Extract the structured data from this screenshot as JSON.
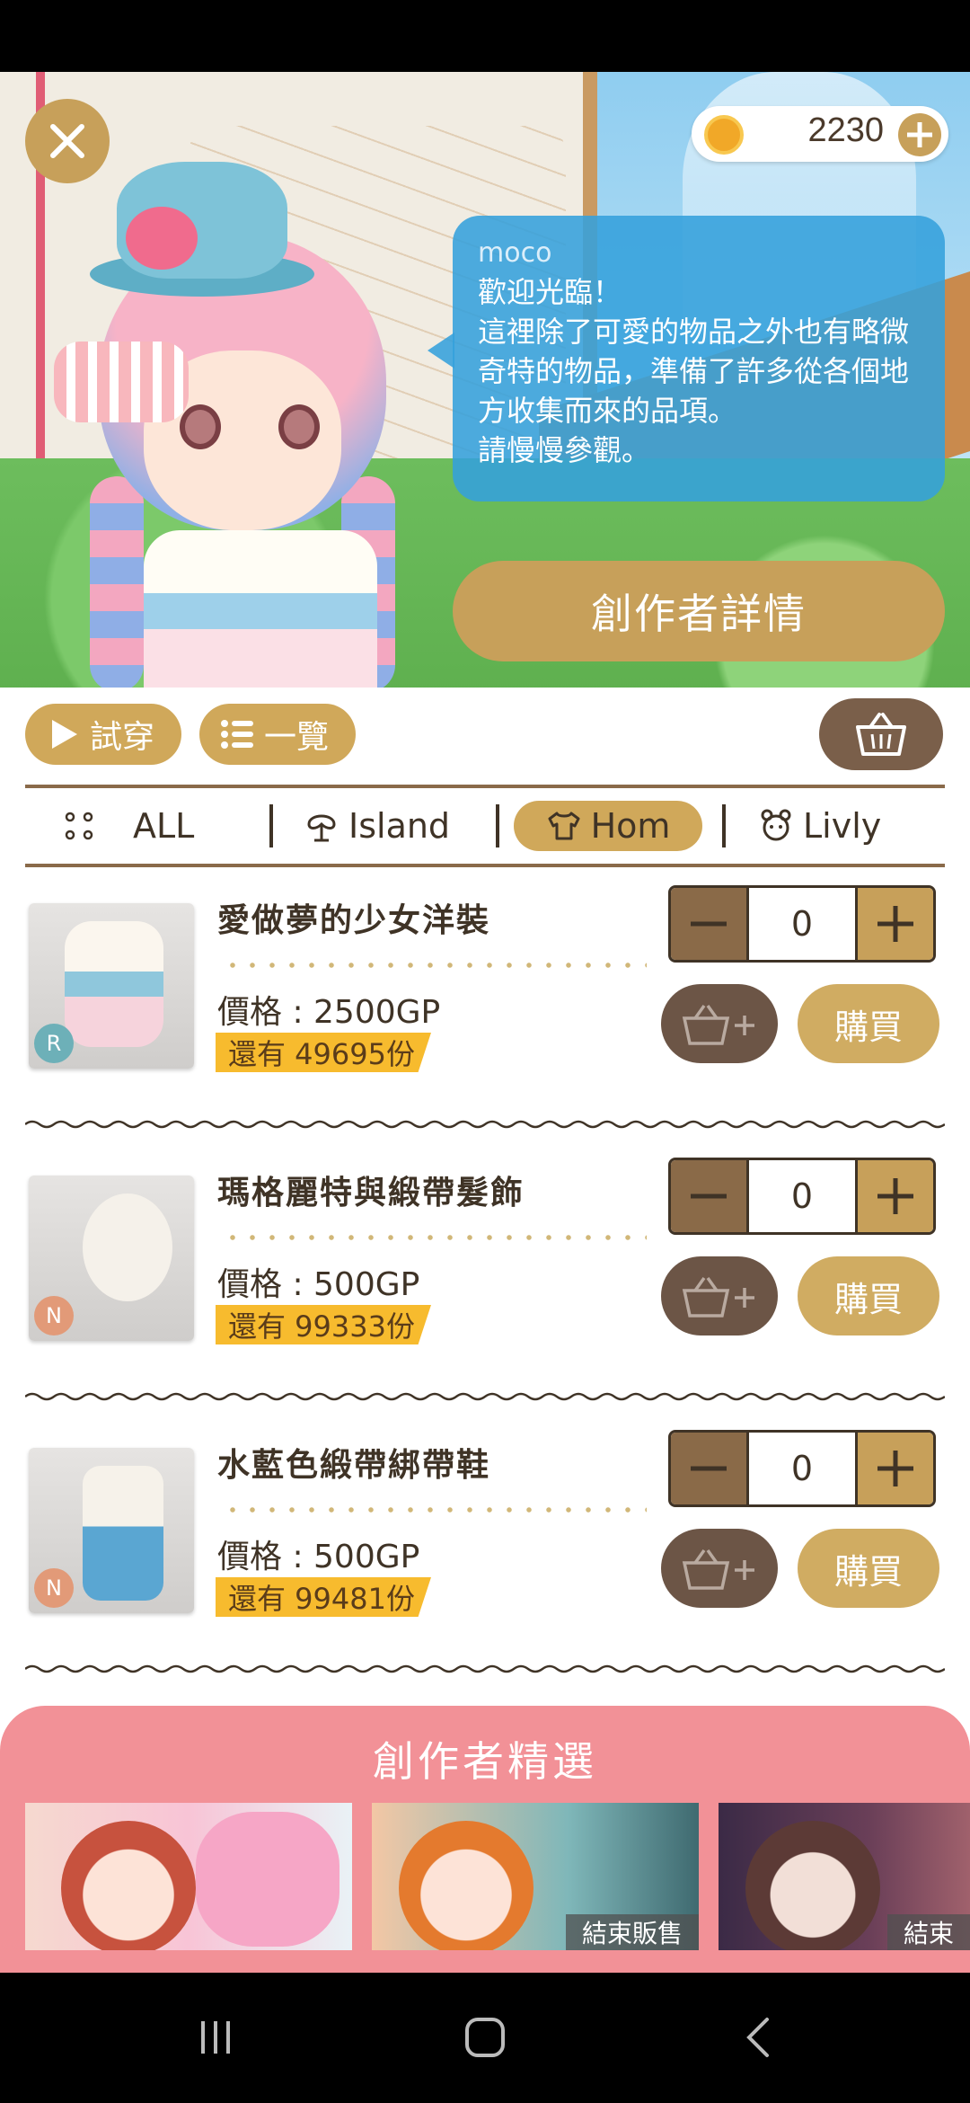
{
  "wallet": {
    "coins": "2230"
  },
  "speech": {
    "name": "moco",
    "text": "歡迎光臨！\n這裡除了可愛的物品之外也有略微奇特的物品，準備了許多從各個地方收集而來的品項。\n請慢慢參觀。"
  },
  "hero": {
    "creator_button": "創作者詳情"
  },
  "toolbar": {
    "try_on": "試穿",
    "list_view": "一覽"
  },
  "tabs": [
    {
      "label": "ALL",
      "icon": "dots-icon",
      "selected": false
    },
    {
      "label": "Island",
      "icon": "tree-icon",
      "selected": false
    },
    {
      "label": "Hom",
      "icon": "shirt-icon",
      "selected": true
    },
    {
      "label": "Livly",
      "icon": "livly-icon",
      "selected": false
    }
  ],
  "products": [
    {
      "name": "愛做夢的少女洋裝",
      "price": "價格 : 2500GP",
      "stock": "還有 49695份",
      "qty": "0",
      "rarity": "R",
      "buy": "購買"
    },
    {
      "name": "瑪格麗特與緞帶髮飾",
      "price": "價格 : 500GP",
      "stock": "還有 99333份",
      "qty": "0",
      "rarity": "N",
      "buy": "購買"
    },
    {
      "name": "水藍色緞帶綁帶鞋",
      "price": "價格 : 500GP",
      "stock": "還有 99481份",
      "qty": "0",
      "rarity": "N",
      "buy": "購買"
    }
  ],
  "picks": {
    "title": "創作者精選",
    "items": [
      {
        "badge": ""
      },
      {
        "badge": "結束販售"
      },
      {
        "badge": "結束"
      }
    ]
  },
  "colors": {
    "accent": "#c7a05a",
    "panel_pink": "#f29197",
    "stock_yellow": "#f7bb2e",
    "speech_blue": "#34a0dc"
  }
}
